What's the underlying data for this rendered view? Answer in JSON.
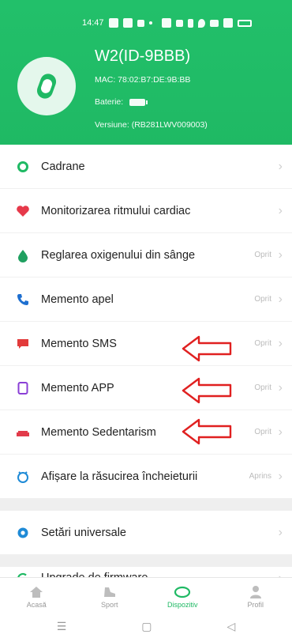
{
  "status_bar": {
    "time": "14:47"
  },
  "device": {
    "name": "W2(ID-9BBB)",
    "mac": "MAC: 78:02:B7:DE:9B:BB",
    "battery_label": "Baterie:",
    "version": "Versiune: (RB281LWV009003)"
  },
  "list": {
    "items": [
      {
        "label": "Cadrane",
        "state": ""
      },
      {
        "label": "Monitorizarea ritmului cardiac",
        "state": ""
      },
      {
        "label": "Reglarea oxigenului din sânge",
        "state": "Oprit"
      },
      {
        "label": "Memento apel",
        "state": "Oprit"
      },
      {
        "label": "Memento SMS",
        "state": "Oprit"
      },
      {
        "label": "Memento APP",
        "state": "Oprit"
      },
      {
        "label": "Memento Sedentarism",
        "state": "Oprit"
      },
      {
        "label": "Afișare la răsucirea încheieturii",
        "state": "Aprins"
      },
      {
        "label": "Setări universale",
        "state": ""
      },
      {
        "label": "Upgrade de firmware",
        "state": ""
      }
    ]
  },
  "bottom_nav": {
    "items": [
      {
        "label": "Acasă"
      },
      {
        "label": "Sport"
      },
      {
        "label": "Dispozitiv"
      },
      {
        "label": "Profil"
      }
    ]
  },
  "colors": {
    "header_green": "#1fb964",
    "annotation_red": "#e02020"
  }
}
